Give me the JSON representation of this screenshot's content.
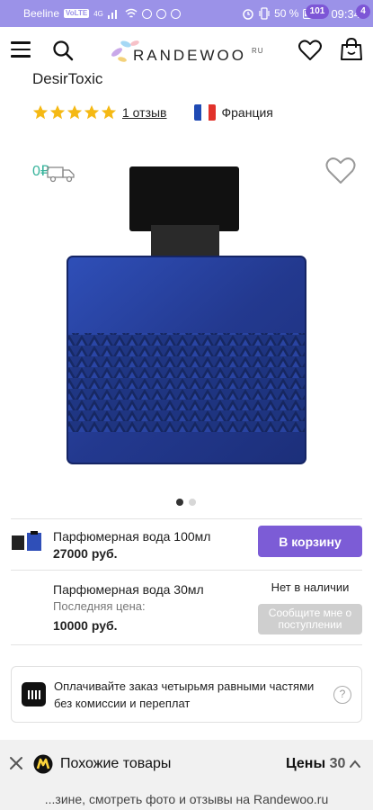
{
  "status_bar": {
    "carrier": "Beeline",
    "volte": "VoLTE",
    "network": "4G",
    "battery": "50 %",
    "time": "09:34"
  },
  "header": {
    "logo_text": "RANDEWOO",
    "logo_suffix": "RU",
    "favorites_count": "101",
    "cart_count": "4"
  },
  "product": {
    "title": "DesirToxic",
    "rating": 5,
    "reviews_label": "1 отзыв",
    "country": "Франция",
    "delivery_price": "0₽",
    "gallery_total": 2,
    "gallery_active": 0
  },
  "variants": [
    {
      "name": "Парфюмерная вода 100мл",
      "price": "27000 руб.",
      "button": "В корзину"
    },
    {
      "name": "Парфюмерная вода 30мл",
      "last_price_label": "Последняя цена:",
      "price": "10000 руб.",
      "availability": "Нет в наличии",
      "button": "Сообщите мне о поступлении"
    }
  ],
  "installment": {
    "text": "Оплачивайте заказ четырьмя равными частями без комиссии и переплат",
    "help": "?"
  },
  "similar_bar": {
    "label": "Похожие товары",
    "prices_label": "Цены",
    "prices_count": "30"
  },
  "url_bar": {
    "text": "...зине, смотреть фото и отзывы на Randewoo.ru"
  },
  "colors": {
    "status_bar": "#9b92e8",
    "accent": "#7c5cd6",
    "delivery": "#36b39b",
    "star": "#f5b914"
  }
}
